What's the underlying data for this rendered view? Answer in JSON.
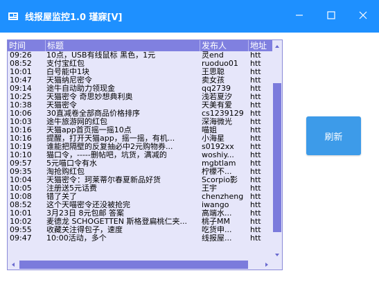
{
  "window": {
    "title": "线报屋监控1.0 瑾寐[V]",
    "controls": {
      "minimize": "minimize-icon",
      "maximize": "maximize-icon",
      "close": "close-icon"
    }
  },
  "colors": {
    "titlebar": "#1e90ff",
    "header": "#8080e0",
    "list_bg": "#e6e6fa",
    "scroll_thumb": "#7b7bdc",
    "button": "#3d9be9"
  },
  "list": {
    "columns": [
      "时间",
      "标题",
      "发布人",
      "地址"
    ],
    "rows": [
      [
        "09:26",
        "10点，USB有线鼠标 黑色，1元",
        "灵end",
        "htt"
      ],
      [
        "08:52",
        "支付宝红包",
        "ruoduo01",
        "htt"
      ],
      [
        "10:01",
        "白号能中1块",
        "王思聪",
        "htt"
      ],
      [
        "10:47",
        "天猫纳尼密令",
        "卖女孩",
        "htt"
      ],
      [
        "09:14",
        "途牛自动助力领现金",
        "qq2739",
        "htt"
      ],
      [
        "10:25",
        "天猫密令 奇思妙想典利奥",
        "浅若夏汐",
        "htt"
      ],
      [
        "10:38",
        "天猫密令",
        "天美有爱",
        "htt"
      ],
      [
        "10:06",
        "30直减卷全部商品价格排序",
        "cs1239129",
        "htt"
      ],
      [
        "10:03",
        "途牛旅游网的红包",
        "深海微光",
        "htt"
      ],
      [
        "10:16",
        "天猫app首页摇一摇10点",
        "喵姐",
        "htt"
      ],
      [
        "10:16",
        "提醒，打开天猫app，摇一摇，有机...",
        "小海星",
        "htt"
      ],
      [
        "10:19",
        "谁能把隔壁的反复抽必中2元购物券...",
        "s0192xx",
        "htt"
      ],
      [
        "10:10",
        "猫口令，-----删帖吧，坑货，满减的",
        "woshiy...",
        "htt"
      ],
      [
        "09:57",
        "5元喵口令有水",
        "mgbtlam",
        "htt"
      ],
      [
        "09:35",
        "淘抢购红包",
        "柠檬不...",
        "htt"
      ],
      [
        "10:04",
        "天猫密令：珂莱蒂尔春夏新品好货",
        "Scorpio影",
        "htt"
      ],
      [
        "10:05",
        "注册送5元话费",
        "王宇",
        "htt"
      ],
      [
        "10:08",
        "错了关了",
        "chenzheng",
        "htt"
      ],
      [
        "08:52",
        "这个天喵密令还没被抢完",
        "iwango",
        "htt"
      ],
      [
        "10:01",
        "3月23日 8元包邮 答案",
        "高端水...",
        "htt"
      ],
      [
        "10:02",
        "麦德龙 SCHOGETTEN 斯格登扁桃仁夹...",
        "桃子MM",
        "htt"
      ],
      [
        "09:55",
        "收藏关注得包子，速度",
        "吃货申...",
        "htt"
      ],
      [
        "09:47",
        "10:00活动，多个",
        "线报屋...",
        "htt"
      ]
    ],
    "scroll": {
      "vertical_position": 0.2,
      "vertical_visible": 0.72,
      "horizontal_visible": 0.92
    }
  },
  "buttons": {
    "refresh": "刷新"
  }
}
